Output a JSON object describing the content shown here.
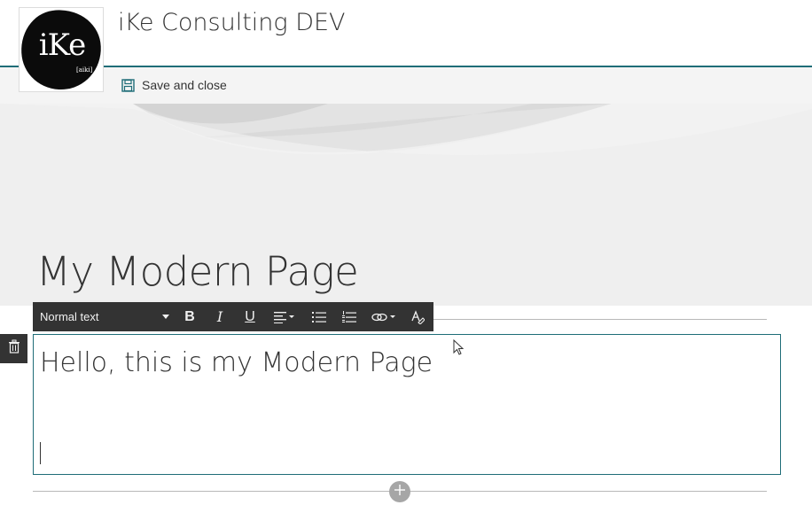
{
  "site": {
    "title": "iKe Consulting DEV",
    "logo_text": "iKe",
    "logo_subtext": "[aiki]"
  },
  "commandbar": {
    "save_label": "Save and close"
  },
  "page": {
    "title": "My Modern Page"
  },
  "toolbar": {
    "style_value": "Normal text",
    "buttons": [
      {
        "name": "bold",
        "label": "B"
      },
      {
        "name": "italic",
        "label": "I"
      },
      {
        "name": "underline",
        "label": "U"
      },
      {
        "name": "align",
        "icon": "align-left-icon"
      },
      {
        "name": "bulleted-list",
        "icon": "bulleted-list-icon"
      },
      {
        "name": "numbered-list",
        "icon": "numbered-list-icon"
      },
      {
        "name": "link",
        "icon": "link-icon"
      },
      {
        "name": "clear-formatting",
        "icon": "clear-format-icon"
      }
    ]
  },
  "editor": {
    "heading_text": "Hello, this is my Modern Page"
  },
  "colors": {
    "accent": "#1f6d78",
    "toolbar_bg": "#333333",
    "banner_bg": "#efefef",
    "commandbar_bg": "#f4f4f4"
  }
}
